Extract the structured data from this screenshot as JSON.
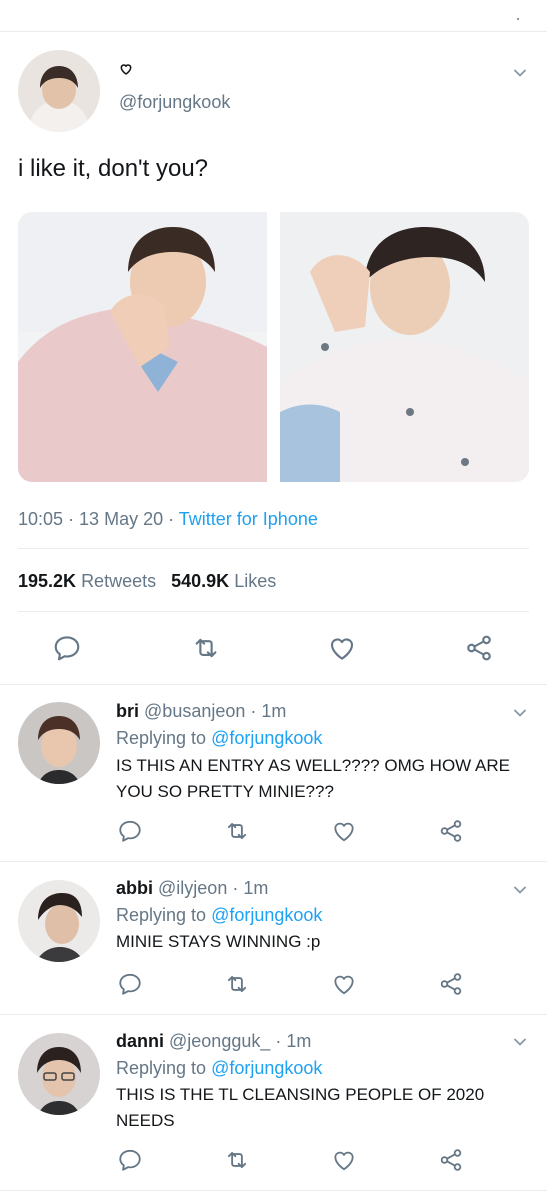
{
  "tweet": {
    "name_icon": "heart-outline-icon",
    "handle": "@forjungkook",
    "text": "i like it, don't you?",
    "time": "10:05",
    "date": "13 May 20",
    "source": "Twitter for Iphone",
    "retweets_count": "195.2K",
    "retweets_label": "Retweets",
    "likes_count": "540.9K",
    "likes_label": "Likes"
  },
  "replies": [
    {
      "name": "bri",
      "handle": "@busanjeon",
      "time": "1m",
      "replying_label": "Replying to",
      "replying_to": "@forjungkook",
      "text": "IS THIS AN ENTRY AS WELL???? OMG HOW ARE YOU SO PRETTY MINIE???"
    },
    {
      "name": "abbi",
      "handle": "@ilyjeon",
      "time": "1m",
      "replying_label": "Replying to",
      "replying_to": "@forjungkook",
      "text": "MINIE STAYS WINNING :p"
    },
    {
      "name": "danni",
      "handle": "@jeongguk_",
      "time": "1m",
      "replying_label": "Replying to",
      "replying_to": "@forjungkook",
      "text": "THIS IS THE TL CLEANSING PEOPLE OF 2020 NEEDS"
    }
  ],
  "colors": {
    "accent": "#1da1f2",
    "secondary_text": "#657786",
    "primary_text": "#14171a",
    "divider": "#e6ecf0",
    "icon": "#657786"
  },
  "icons": [
    "reply-icon",
    "retweet-icon",
    "like-icon",
    "share-icon",
    "chevron-down-icon"
  ]
}
